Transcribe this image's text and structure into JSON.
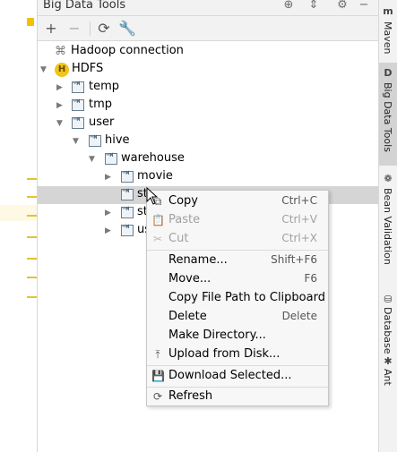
{
  "window": {
    "title": "Big Data Tools"
  },
  "title_icons": [
    "globe-icon",
    "collapse-icon",
    "gear-icon",
    "minimize-icon"
  ],
  "toolbar": {
    "add_label": "+",
    "remove_label": "−",
    "refresh_icon": "refresh-icon",
    "settings_icon": "wrench-icon"
  },
  "tree": {
    "hadoop_connection": "Hadoop connection",
    "hdfs": "HDFS",
    "temp": "temp",
    "tmp": "tmp",
    "user": "user",
    "hive": "hive",
    "warehouse": "warehouse",
    "movie": "movie",
    "row_st1": "st",
    "row_st2": "st",
    "row_us": "us"
  },
  "right_tabs": {
    "maven": "Maven",
    "big_data_tools": "Big Data Tools",
    "bean_validation": "Bean Validation",
    "database": "Database",
    "ant": "Ant"
  },
  "context_menu": {
    "copy": {
      "label": "Copy",
      "shortcut": "Ctrl+C"
    },
    "paste": {
      "label": "Paste",
      "shortcut": "Ctrl+V",
      "disabled": true
    },
    "cut": {
      "label": "Cut",
      "shortcut": "Ctrl+X",
      "disabled": true
    },
    "rename": {
      "label": "Rename...",
      "shortcut": "Shift+F6"
    },
    "move": {
      "label": "Move...",
      "shortcut": "F6"
    },
    "copy_path": {
      "label": "Copy File Path to Clipboard"
    },
    "delete": {
      "label": "Delete",
      "shortcut": "Delete"
    },
    "make_dir": {
      "label": "Make Directory..."
    },
    "upload": {
      "label": "Upload from Disk..."
    },
    "download": {
      "label": "Download Selected..."
    },
    "refresh": {
      "label": "Refresh"
    }
  },
  "colors": {
    "selection": "#d5d5d5",
    "menu_bg": "#f7f7f7",
    "accent_yellow": "#f2c200"
  }
}
